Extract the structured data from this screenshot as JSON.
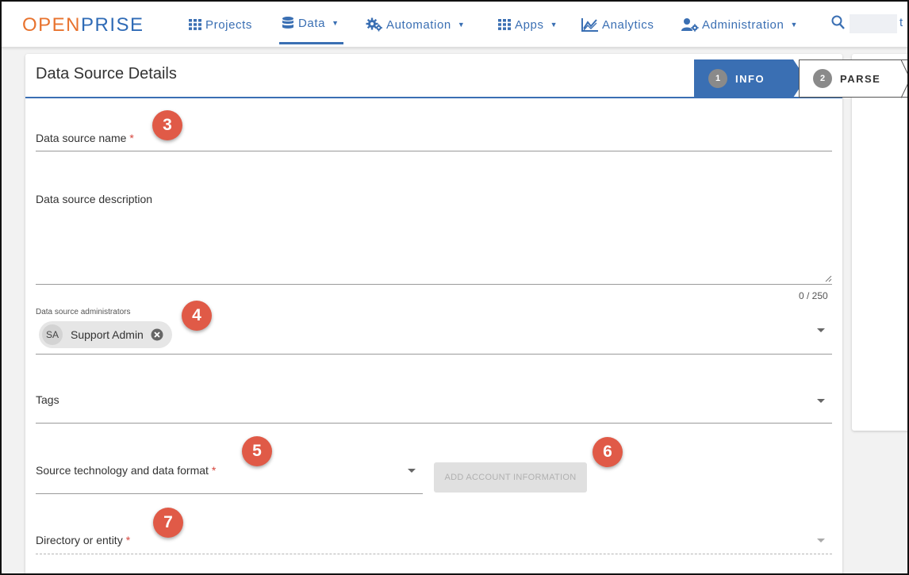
{
  "brand": {
    "logo_part1": "OPEN",
    "logo_part2": "PRISE",
    "color_orange": "#e8732e",
    "color_blue": "#2f6bb6"
  },
  "nav": {
    "items": [
      {
        "label": "Projects",
        "icon": "grid-icon",
        "has_caret": false
      },
      {
        "label": "Data",
        "icon": "database-icon",
        "has_caret": true,
        "active": true
      },
      {
        "label": "Automation",
        "icon": "gears-icon",
        "has_caret": true
      },
      {
        "label": "Apps",
        "icon": "grid-icon",
        "has_caret": true
      },
      {
        "label": "Analytics",
        "icon": "chart-icon",
        "has_caret": false
      },
      {
        "label": "Administration",
        "icon": "user-gear-icon",
        "has_caret": true
      }
    ],
    "search_tail": "t",
    "accent": "#3a6fb3"
  },
  "card": {
    "title": "Data Source Details",
    "steps": [
      {
        "number": "1",
        "label": "INFO",
        "active": true
      },
      {
        "number": "2",
        "label": "PARSE",
        "active": false
      }
    ]
  },
  "form": {
    "name_label": "Data source name",
    "description_label": "Data source description",
    "description_counter": "0 / 250",
    "admins_label": "Data source administrators",
    "admin_chip": {
      "initials": "SA",
      "name": "Support Admin"
    },
    "tags_label": "Tags",
    "source_tech_label": "Source technology and data format",
    "add_account_label": "ADD ACCOUNT INFORMATION",
    "directory_label": "Directory or entity",
    "required_mark": "*"
  },
  "callouts": {
    "c3": "3",
    "c4": "4",
    "c5": "5",
    "c6": "6",
    "c7": "7",
    "color": "#e05a47"
  }
}
